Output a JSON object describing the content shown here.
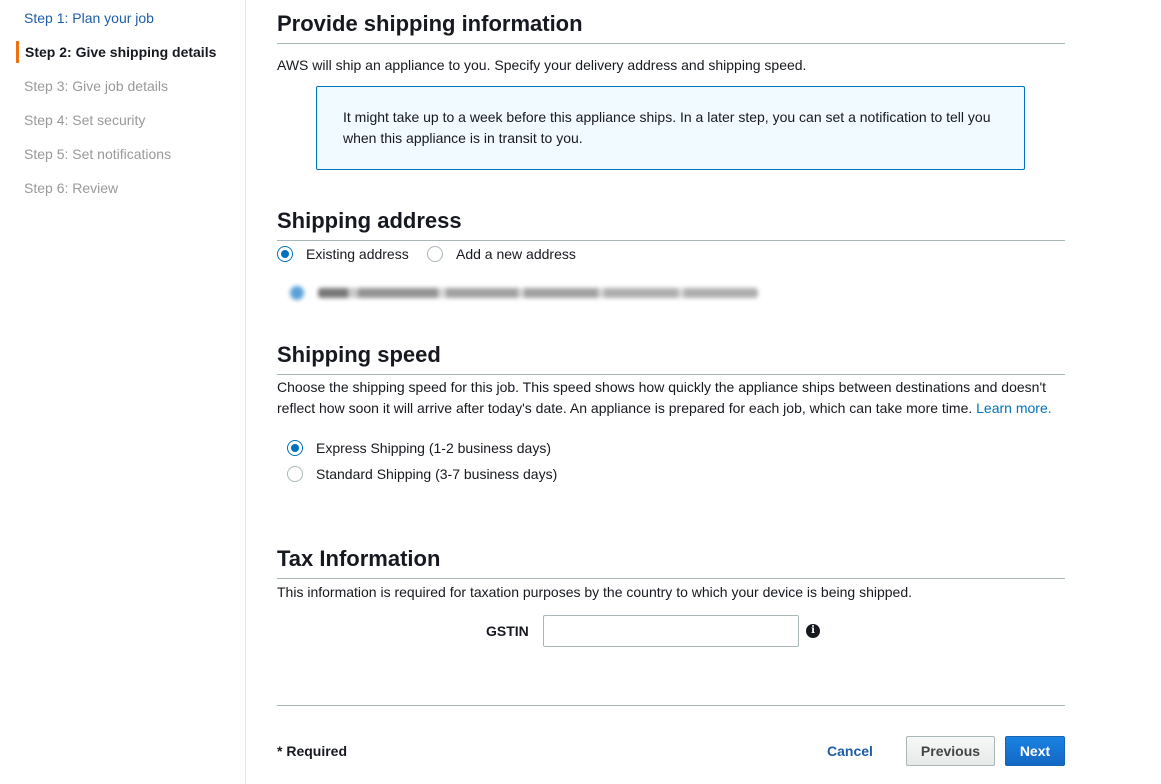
{
  "sidebar": {
    "steps": [
      {
        "label": "Step 1: Plan your job"
      },
      {
        "label": "Step 2: Give shipping details"
      },
      {
        "label": "Step 3: Give job details"
      },
      {
        "label": "Step 4: Set security"
      },
      {
        "label": "Step 5: Set notifications"
      },
      {
        "label": "Step 6: Review"
      }
    ]
  },
  "shipping_info": {
    "title": "Provide shipping information",
    "description": "AWS will ship an appliance to you. Specify your delivery address and shipping speed.",
    "notice": "It might take up to a week before this appliance ships. In a later step, you can set a notification to tell you when this appliance is in transit to you."
  },
  "shipping_address": {
    "title": "Shipping address",
    "options": [
      {
        "label": "Existing address",
        "selected": true
      },
      {
        "label": "Add a new address",
        "selected": false
      }
    ]
  },
  "shipping_speed": {
    "title": "Shipping speed",
    "description": "Choose the shipping speed for this job. This speed shows how quickly the appliance ships between destinations and doesn't reflect how soon it will arrive after today's date. An appliance is prepared for each job, which can take more time.",
    "learn_more": "Learn more.",
    "options": [
      {
        "label": "Express Shipping (1-2 business days)",
        "selected": true
      },
      {
        "label": "Standard Shipping (3-7 business days)",
        "selected": false
      }
    ]
  },
  "tax": {
    "title": "Tax Information",
    "description": "This information is required for taxation purposes by the country to which your device is being shipped.",
    "gstin_label": "GSTIN",
    "gstin_value": "",
    "info_icon_glyph": "i"
  },
  "footer": {
    "required_note": "* Required",
    "cancel_label": "Cancel",
    "previous_label": "Previous",
    "next_label": "Next"
  },
  "colors": {
    "accent": "#0073bb",
    "current_step_marker": "#ec7211",
    "primary_button": "#1a82e2"
  }
}
